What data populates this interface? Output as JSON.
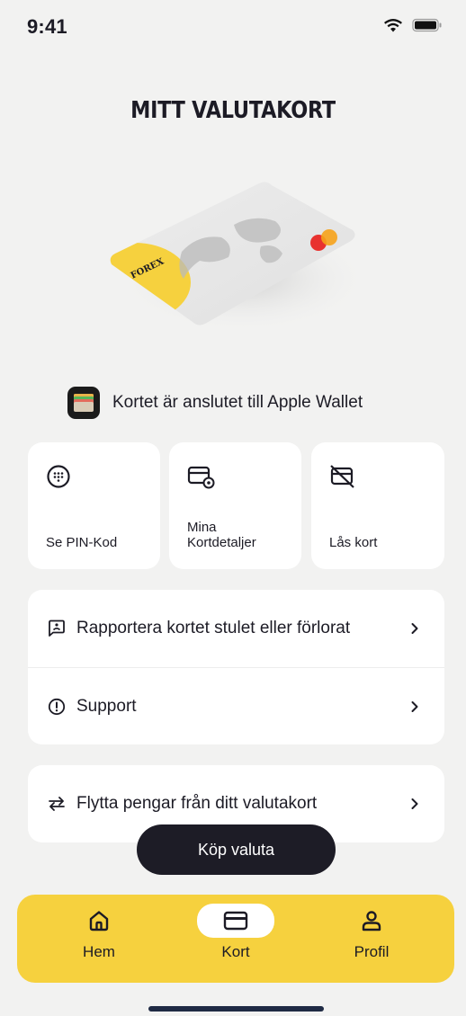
{
  "status_bar": {
    "time": "9:41"
  },
  "page": {
    "title": "MITT VALUTAKORT"
  },
  "card": {
    "brand_text": "FOREX"
  },
  "wallet": {
    "text": "Kortet är anslutet till Apple Wallet"
  },
  "tiles": [
    {
      "label": "Se PIN-Kod",
      "icon": "pin-grid-icon"
    },
    {
      "label": "Mina\nKortdetaljer",
      "line1": "Mina",
      "line2": "Kortdetaljer",
      "icon": "card-settings-icon"
    },
    {
      "label": "Lås kort",
      "icon": "card-lock-icon"
    }
  ],
  "list": [
    {
      "label": "Rapportera kortet stulet eller förlorat",
      "icon": "report-icon"
    },
    {
      "label": "Support",
      "icon": "info-icon"
    },
    {
      "label": "Flytta pengar från ditt valutakort",
      "icon": "transfer-icon"
    }
  ],
  "buy_button": {
    "label": "Köp valuta"
  },
  "tabbar": {
    "items": [
      {
        "label": "Hem",
        "icon": "home-icon"
      },
      {
        "label": "Kort",
        "icon": "card-icon",
        "active": true
      },
      {
        "label": "Profil",
        "icon": "profile-icon"
      }
    ]
  },
  "colors": {
    "accent": "#f6d13e",
    "dark": "#1d1c26",
    "background": "#f2f2f1"
  }
}
